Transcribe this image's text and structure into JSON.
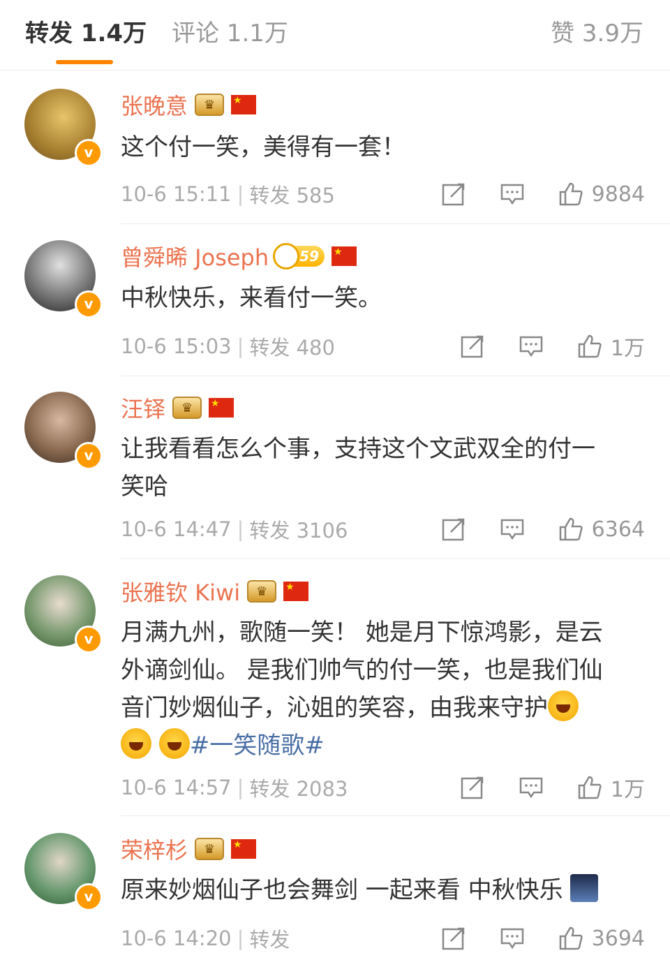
{
  "tabs": {
    "repost": "转发 1.4万",
    "comment": "评论 1.1万",
    "like": "赞 3.9万"
  },
  "comments": [
    {
      "name": "张晚意",
      "text": "这个付一笑，美得有一套！",
      "date": "10-6 15:11",
      "repost": "转发 585",
      "likes": "9884",
      "avatar_color": "#c8a050"
    },
    {
      "name": "曾舜晞 Joseph",
      "level": "59",
      "text": "中秋快乐，来看付一笑。",
      "date": "10-6 15:03",
      "repost": "转发 480",
      "likes": "1万",
      "avatar_color": "#555555"
    },
    {
      "name": "汪铎",
      "text_line1": "让我看看怎么个事，支持这个文武双全的付一",
      "text_line2": "笑哈",
      "date": "10-6 14:47",
      "repost": "转发 3106",
      "likes": "6364",
      "avatar_color": "#8a6a50"
    },
    {
      "name": "张雅钦 Kiwi",
      "text_line1": "月满九州，歌随一笑！ 她是月下惊鸿影，是云",
      "text_line2": "外谪剑仙。 是我们帅气的付一笑，也是我们仙",
      "text_line3": "音门妙烟仙子，沁姐的笑容，由我来守护",
      "hashtag": "#一笑随歌#",
      "date": "10-6 14:57",
      "repost": "转发 2083",
      "likes": "1万",
      "avatar_color": "#6a8a60"
    },
    {
      "name": "荣梓杉",
      "text": "原来妙烟仙子也会舞剑 一起来看 中秋快乐",
      "date": "10-6 14:20",
      "repost": "转发 ",
      "likes": "3694",
      "avatar_color": "#4a7a50"
    }
  ],
  "colors": {
    "accent": "#ff8200",
    "name": "#eb7350",
    "meta": "#aaaaaa",
    "hashtag": "#4a6fa5"
  }
}
